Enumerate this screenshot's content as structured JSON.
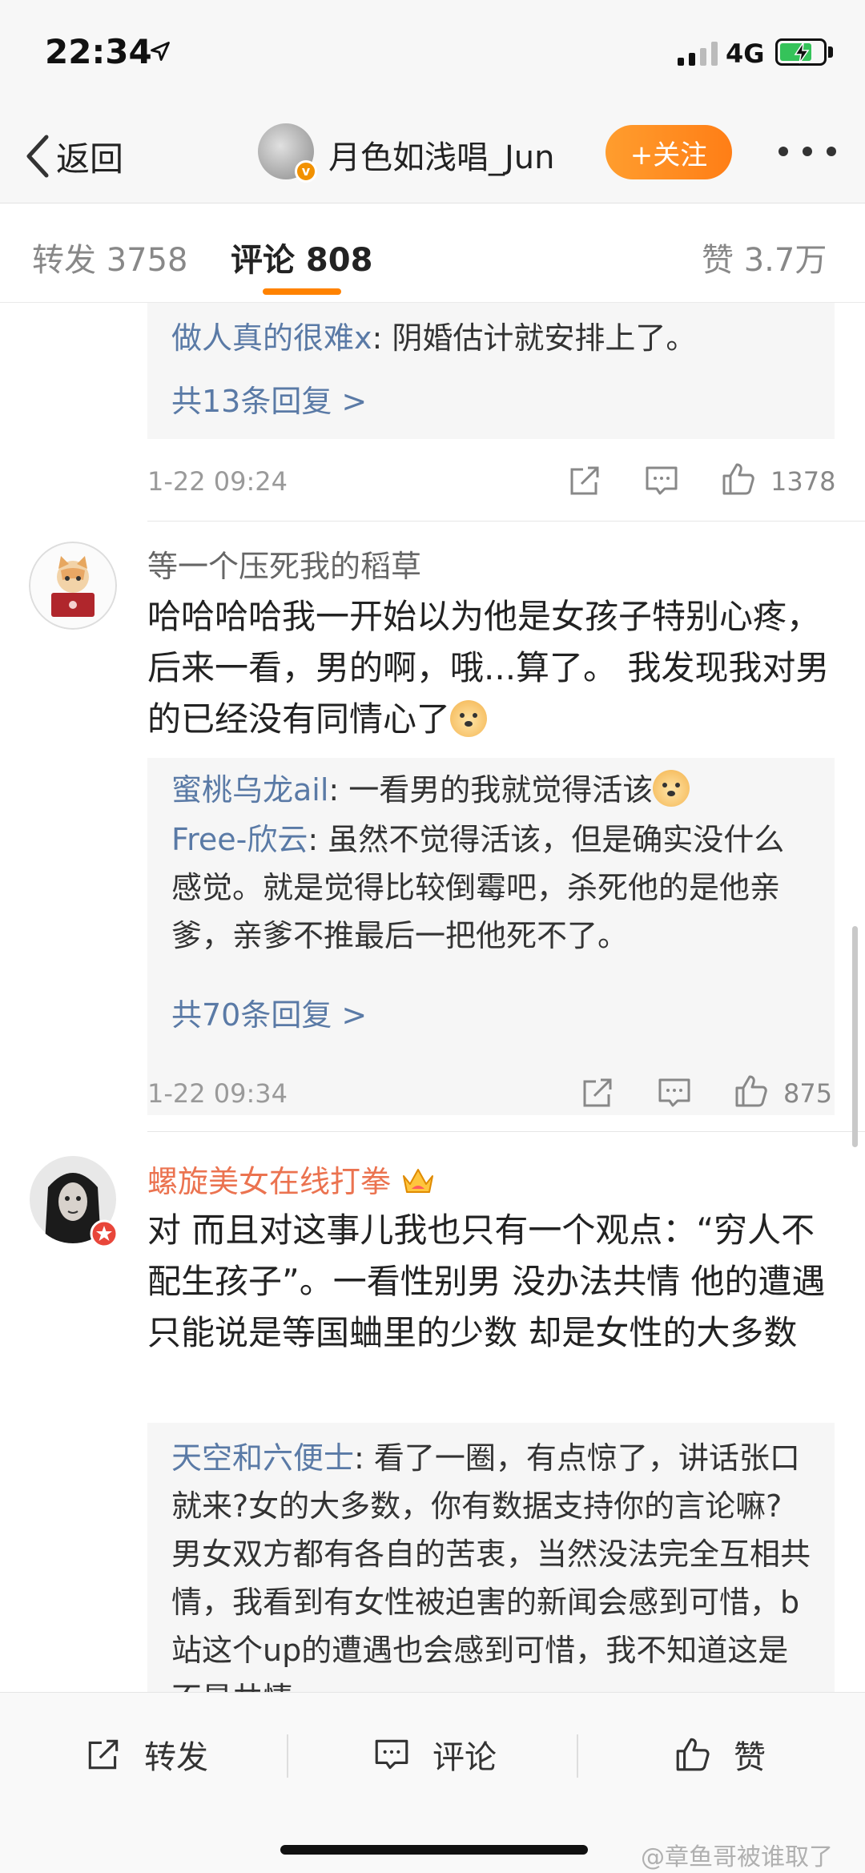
{
  "status_bar": {
    "time": "22:34",
    "network": "4G"
  },
  "nav": {
    "back_label": "返回",
    "username": "月色如浅唱_Jun",
    "follow_label": "+关注"
  },
  "tabs": [
    {
      "label": "转发 3758"
    },
    {
      "label": "评论 808"
    },
    {
      "label": "赞 3.7万"
    }
  ],
  "comments": [
    {
      "partial": true,
      "replies": [
        {
          "name": "做人真的很难x",
          "text": ": 阴婚估计就安排上了。"
        }
      ],
      "more_replies": "共13条回复 >",
      "time": "1-22 09:24",
      "likes": "1378"
    },
    {
      "author": "等一个压死我的稻草",
      "text": "哈哈哈哈我一开始以为他是女孩子特别心疼，后来一看，男的啊，哦...算了。 我发现我对男的已经没有同情心了",
      "replies": [
        {
          "name": "蜜桃乌龙ail",
          "text": ": 一看男的我就觉得活该"
        },
        {
          "name": "Free-欣云",
          "text": ": 虽然不觉得活该，但是确实没什么感觉。就是觉得比较倒霉吧，杀死他的是他亲爹，亲爹不推最后一把他死不了。"
        }
      ],
      "more_replies": "共70条回复 >",
      "time": "1-22 09:34",
      "likes": "875"
    },
    {
      "author": "螺旋美女在线打拳",
      "text": "对 而且对这事儿我也只有一个观点：“穷人不配生孩子”。一看性别男 没办法共情 他的遭遇只能说是等国蛐里的少数 却是女性的大多数",
      "replies": [
        {
          "name": "天空和六便士",
          "text": ": 看了一圈，有点惊了，讲话张口就来?女的大多数，你有数据支持你的言论嘛?男女双方都有各自的苦衷，当然没法完全互相共情，我看到有女性被迫害的新闻会感到可惜，b站这个up的遭遇也会感到可惜，我不知道这是不是共情"
        }
      ]
    }
  ],
  "bottom_bar": {
    "repost": "转发",
    "comment": "评论",
    "like": "赞"
  },
  "watermark": "@章鱼哥被谁取了",
  "colors": {
    "accent": "#ff8200",
    "reply_name": "#5a7aa6",
    "vip_name": "#eb7350"
  }
}
